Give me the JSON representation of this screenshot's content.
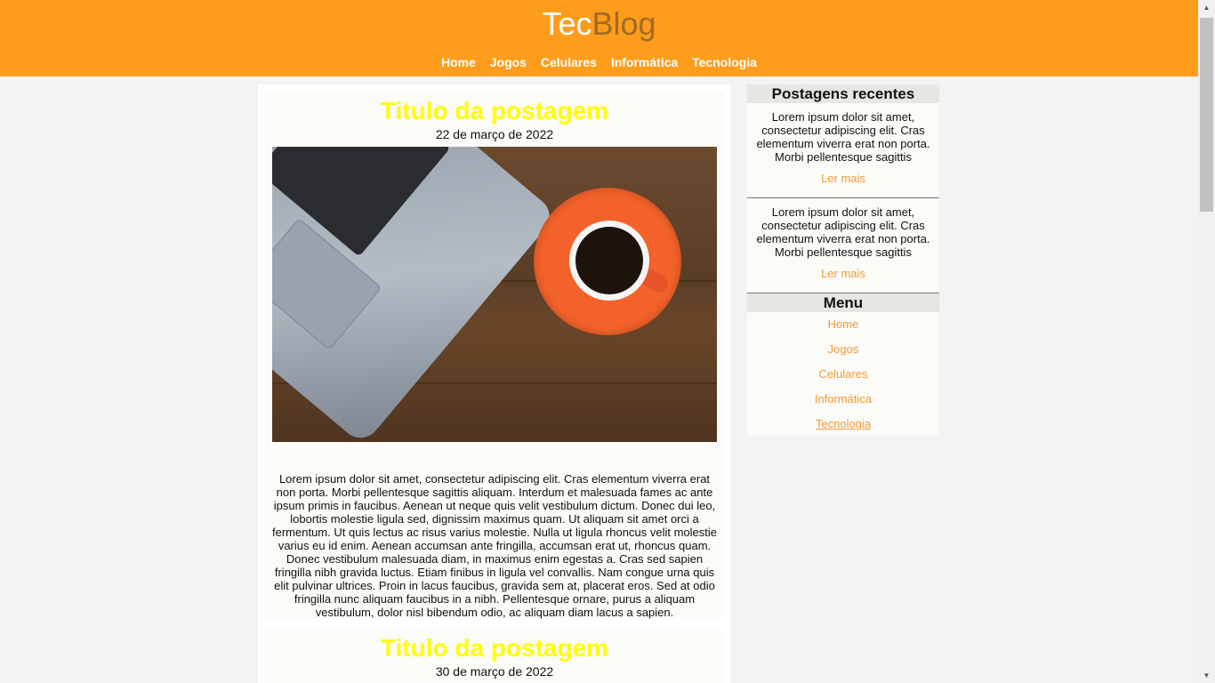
{
  "header": {
    "logo_tec": "Tec",
    "logo_blog": "Blog",
    "nav": [
      "Home",
      "Jogos",
      "Celulares",
      "Informática",
      "Tecnologia"
    ]
  },
  "posts": [
    {
      "title": "Titulo da postagem",
      "date": "22 de março de 2022",
      "body": "Lorem ipsum dolor sit amet, consectetur adipiscing elit. Cras elementum viverra erat non porta. Morbi pellentesque sagittis aliquam. Interdum et malesuada fames ac ante ipsum primis in faucibus. Aenean ut neque quis velit vestibulum dictum. Donec dui leo, lobortis molestie ligula sed, dignissim maximus quam. Ut aliquam sit amet orci a fermentum. Ut quis lectus ac risus varius molestie. Nulla ut ligula rhoncus velit molestie varius eu id enim. Aenean accumsan ante fringilla, accumsan erat ut, rhoncus quam. Donec vestibulum malesuada diam, in maximus enim egestas a. Cras sed sapien fringilla nibh gravida luctus. Etiam finibus in ligula vel convallis. Nam congue urna quis elit pulvinar ultrices. Proin in lacus faucibus, gravida sem at, placerat eros. Sed at odio fringilla nunc aliquam faucibus in a nibh. Pellentesque ornare, purus a aliquam vestibulum, dolor nisl bibendum odio, ac aliquam diam lacus a sapien."
    },
    {
      "title": "Titulo da postagem",
      "date": "30 de março de 2022"
    }
  ],
  "sidebar": {
    "recent_heading": "Postagens recentes",
    "recent": [
      {
        "text": "Lorem ipsum dolor sit amet, consectetur adipiscing elit. Cras elementum viverra erat non porta. Morbi pellentesque sagittis",
        "link": "Ler mais"
      },
      {
        "text": "Lorem ipsum dolor sit amet, consectetur adipiscing elit. Cras elementum viverra erat non porta. Morbi pellentesque sagittis",
        "link": "Ler mais"
      }
    ],
    "menu_heading": "Menu",
    "menu": [
      "Home",
      "Jogos",
      "Celulares",
      "Informática",
      "Tecnologia"
    ]
  },
  "colors": {
    "header_bg": "#fd9d1b",
    "title": "#ffff00",
    "link": "#f1993a",
    "logo_accent": "#a36b22"
  },
  "icons": {
    "scroll_up": "triangle-up-icon",
    "scroll_down": "triangle-down-icon"
  }
}
